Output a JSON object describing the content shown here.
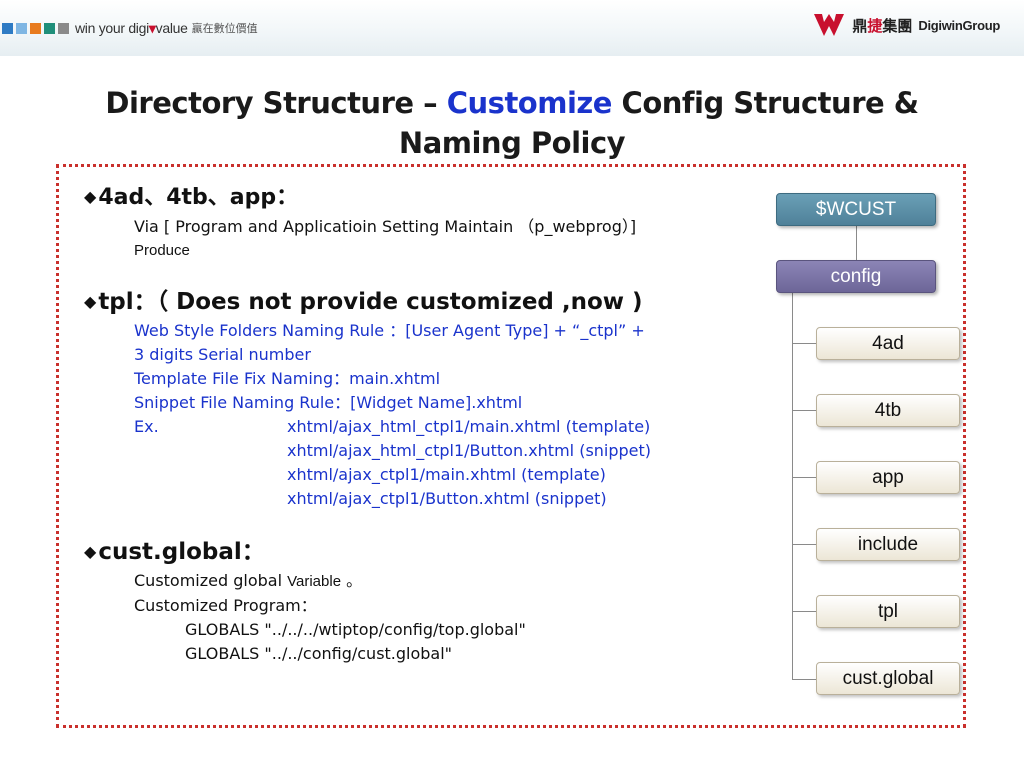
{
  "header": {
    "squares": [
      "#2e7bc4",
      "#7fb6e3",
      "#e87b1e",
      "#1f8f7a",
      "#8a8a8a"
    ],
    "slogan": {
      "part1": "win your digi",
      "part2": "value"
    },
    "slogan_cn": "贏在數位價值",
    "logo_cn": {
      "part1": "鼎",
      "part2": "捷",
      "part3": "集團"
    },
    "logo_en": "DigiwinGroup"
  },
  "title": {
    "part1": "Directory Structure – ",
    "accent": "Customize",
    "part2": " Config Structure &",
    "line2": "Naming Policy"
  },
  "sections": {
    "s1": {
      "heading": "4ad、4tb、app：",
      "line1": "Via [ Program and Applicatioin Setting Maintain （p_webprog）]",
      "line2": "Produce"
    },
    "s2": {
      "heading": "tpl：（ Does not provide customized ,now )",
      "rule1": "Web Style Folders Naming Rule ：[User Agent Type] +  “_ctpl”  +",
      "rule2": "3  digits Serial number",
      "rule3": "Template File Fix Naming：main.xhtml",
      "rule4": "Snippet File Naming Rule：[Widget Name].xhtml",
      "ex_label": "Ex.",
      "examples": [
        "xhtml/ajax_html_ctpl1/main.xhtml (template)",
        "xhtml/ajax_html_ctpl1/Button.xhtml (snippet)",
        "xhtml/ajax_ctpl1/main.xhtml (template)",
        "xhtml/ajax_ctpl1/Button.xhtml (snippet)"
      ]
    },
    "s3": {
      "heading": "cust.global：",
      "line1a": "Customized global ",
      "line1b": "Variable",
      "line1c": " 。",
      "line2": "Customized Program：",
      "globals": [
        "GLOBALS \"../../../wtiptop/config/top.global\"",
        "GLOBALS \"../../config/cust.global\""
      ]
    }
  },
  "tree": {
    "root": "$WCUST",
    "config": "config",
    "children": [
      "4ad",
      "4tb",
      "app",
      "include",
      "tpl",
      "cust.global"
    ]
  },
  "colors": {
    "accent_blue": "#1a33cc",
    "frame_red": "#c9302c"
  }
}
